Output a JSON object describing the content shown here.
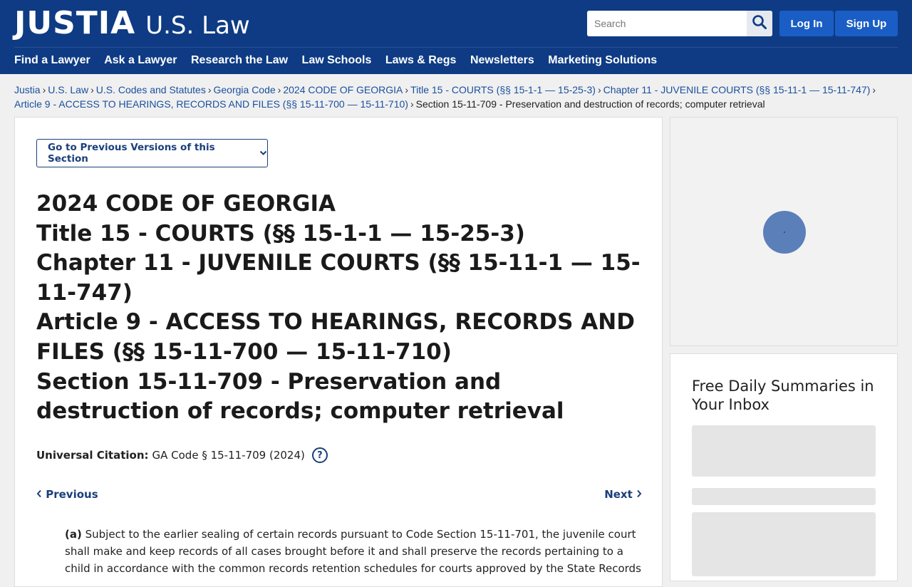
{
  "header": {
    "logo_main": "JUSTIA",
    "logo_sub": "U.S. Law",
    "search_placeholder": "Search",
    "login_label": "Log In",
    "signup_label": "Sign Up"
  },
  "nav": {
    "items": [
      "Find a Lawyer",
      "Ask a Lawyer",
      "Research the Law",
      "Law Schools",
      "Laws & Regs",
      "Newsletters",
      "Marketing Solutions"
    ]
  },
  "breadcrumb": {
    "links": [
      "Justia",
      "U.S. Law",
      "U.S. Codes and Statutes",
      "Georgia Code",
      "2024 CODE OF GEORGIA",
      "Title 15 - COURTS (§§ 15-1-1 — 15-25-3)",
      "Chapter 11 - JUVENILE COURTS (§§ 15-11-1 — 15-11-747)",
      "Article 9 - ACCESS TO HEARINGS, RECORDS AND FILES (§§ 15-11-700 — 15-11-710)"
    ],
    "current": "Section 15-11-709 - Preservation and destruction of records; computer retrieval",
    "separator": "›"
  },
  "main": {
    "prev_versions_label": "Go to Previous Versions of this Section",
    "heading": {
      "code": "2024 CODE OF GEORGIA",
      "title": "Title 15 - COURTS (§§ 15-1-1 — 15-25-3)",
      "chapter": "Chapter 11 - JUVENILE COURTS (§§ 15-11-1 — 15-11-747)",
      "article": "Article 9 - ACCESS TO HEARINGS, RECORDS AND FILES (§§ 15-11-700 — 15-11-710)",
      "section": "Section 15-11-709 - Preservation and destruction of records; computer retrieval"
    },
    "citation_label": "Universal Citation:",
    "citation_value": "GA Code § 15-11-709 (2024)",
    "help_label": "?",
    "previous_label": "Previous",
    "next_label": "Next",
    "paragraph_a_label": "(a)",
    "paragraph_a_text": "Subject to the earlier sealing of certain records pursuant to Code Section 15-11-701, the juvenile court shall make and keep records of all cases brought before it and shall preserve the records pertaining to a child in accordance with the common records retention schedules for courts approved by the State Records"
  },
  "sidebar": {
    "newsletter_title": "Free Daily Summaries in Your Inbox"
  }
}
